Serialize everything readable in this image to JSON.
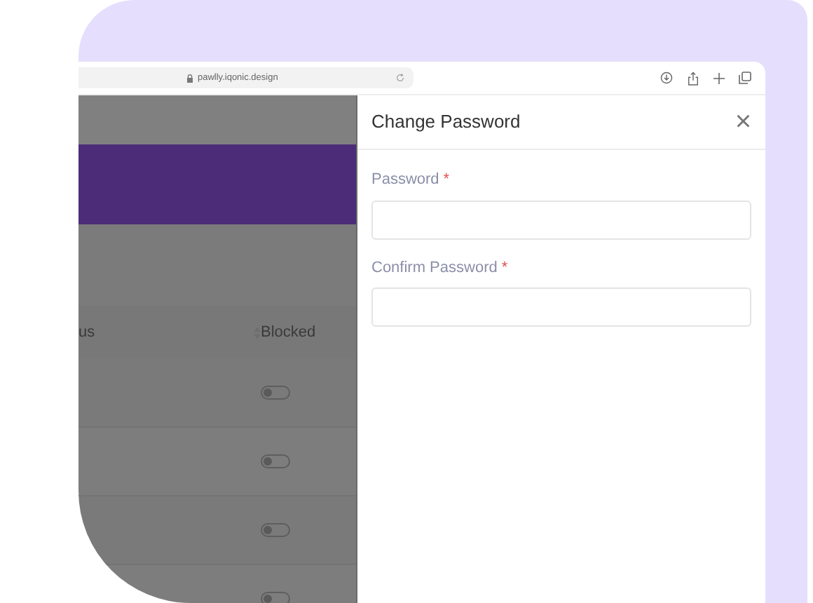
{
  "browser": {
    "url": "pawlly.iqonic.design"
  },
  "table": {
    "columns": [
      {
        "label": "us",
        "sortable": true
      },
      {
        "label": "Blocked",
        "sortable": false
      }
    ],
    "rows": [
      {
        "blocked": false
      },
      {
        "blocked": false
      },
      {
        "blocked": false
      },
      {
        "blocked": false
      }
    ]
  },
  "drawer": {
    "title": "Change Password",
    "close": "×",
    "required_mark": "*",
    "fields": [
      {
        "label": "Password",
        "required": true
      },
      {
        "label": "Confirm Password",
        "required": true
      }
    ]
  }
}
